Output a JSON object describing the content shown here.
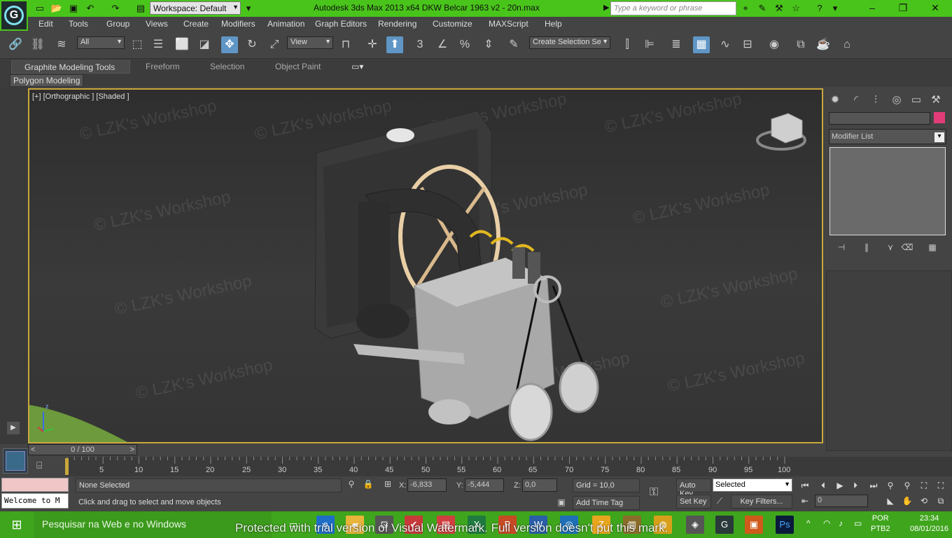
{
  "titlebar": {
    "workspace": "Workspace: Default",
    "title": "Autodesk 3ds Max  2013 x64     DKW Belcar 1963 v2 - 20n.max",
    "search_placeholder": "Type a keyword or phrase",
    "minimize": "–",
    "restore": "❐",
    "close": "✕"
  },
  "menu": [
    "Edit",
    "Tools",
    "Group",
    "Views",
    "Create",
    "Modifiers",
    "Animation",
    "Graph Editors",
    "Rendering",
    "Customize",
    "MAXScript",
    "Help"
  ],
  "toolbar": {
    "selection_filter": "All",
    "ref_coord": "View",
    "named_selection_placeholder": "Create Selection Se",
    "snap_label": "3",
    "percent_label": "%"
  },
  "ribbon": {
    "tabs": [
      "Graphite Modeling Tools",
      "Freeform",
      "Selection",
      "Object Paint"
    ],
    "panel": "Polygon Modeling"
  },
  "viewport": {
    "label": "[+] [Orthographic ] [Shaded ]",
    "watermark": "© LZK's Workshop"
  },
  "command_panel": {
    "modifier_list": "Modifier List",
    "color_swatch": "#e23c78"
  },
  "timeline": {
    "slider": "0 / 100",
    "ticks": [
      "5",
      "10",
      "15",
      "20",
      "25",
      "30",
      "35",
      "40",
      "45",
      "50",
      "55",
      "60",
      "65",
      "70",
      "75",
      "80",
      "85",
      "90",
      "95",
      "100"
    ]
  },
  "status": {
    "maxscript": "Welcome to M",
    "selection": "None Selected",
    "prompt": "Click and drag to select and move objects",
    "x_label": "X:",
    "x_value": "-6,833",
    "y_label": "Y:",
    "y_value": "-5,444",
    "z_label": "Z:",
    "z_value": "0,0",
    "grid": "Grid = 10,0",
    "add_time_tag": "Add Time Tag",
    "auto_key": "Auto Key",
    "set_key": "Set Key",
    "selected": "Selected",
    "key_filters": "Key Filters...",
    "frame": "0"
  },
  "taskbar": {
    "search": "Pesquisar na Web e no Windows",
    "watermark": "Protected with trial version of Visual Watermark. Full version doesn't put this mark.",
    "lang_line1": "POR",
    "lang_line2": "PTB2",
    "time": "23:34",
    "date": "08/01/2016"
  }
}
